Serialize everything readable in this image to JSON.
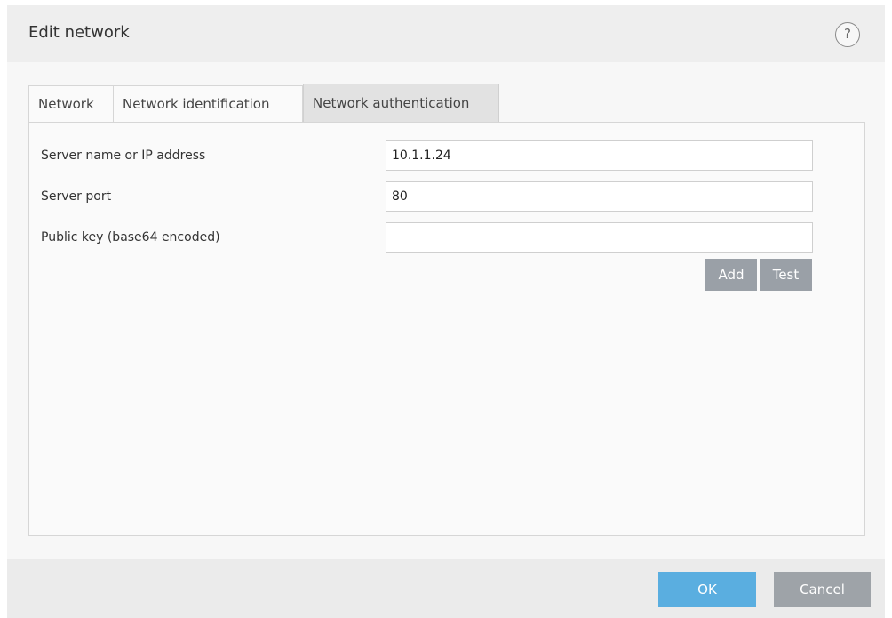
{
  "dialog": {
    "title": "Edit network",
    "help_icon": "question-circle-icon",
    "help_glyph": "?"
  },
  "tabs": [
    {
      "label": "Network",
      "active": false
    },
    {
      "label": "Network identification",
      "active": false
    },
    {
      "label": "Network authentication",
      "active": true
    }
  ],
  "fields": {
    "server_name": {
      "label": "Server name or IP address",
      "value": "10.1.1.24"
    },
    "server_port": {
      "label": "Server port",
      "value": "80"
    },
    "public_key": {
      "label": "Public key (base64 encoded)",
      "value": ""
    }
  },
  "buttons": {
    "add": "Add",
    "test": "Test",
    "ok": "OK",
    "cancel": "Cancel"
  },
  "colors": {
    "ok_button": "#5aaee0",
    "secondary_button": "#9ea3a8",
    "active_tab": "#e2e2e2"
  }
}
